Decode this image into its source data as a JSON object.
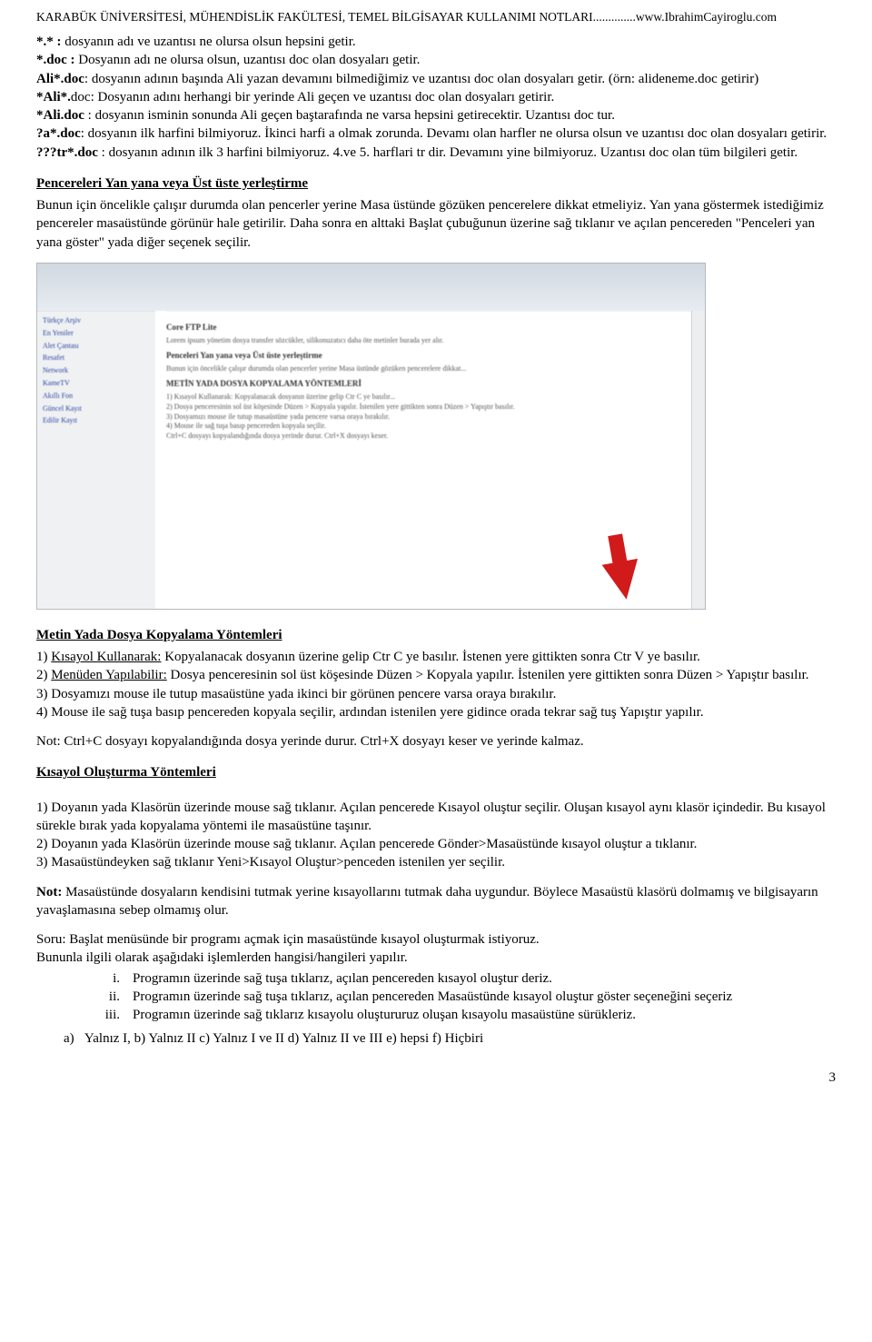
{
  "header": "KARABÜK ÜNİVERSİTESİ, MÜHENDİSLİK FAKÜLTESİ, TEMEL BİLGİSAYAR KULLANIMI NOTLARI..............www.IbrahimCayiroglu.com",
  "wild": {
    "l1a": "*.*  :",
    "l1b": " dosyanın adı ve uzantısı ne olursa olsun hepsini getir.",
    "l2a": "*.doc :",
    "l2b": " Dosyanın adı ne olursa olsun, uzantısı doc olan dosyaları getir.",
    "l3a": "Ali*.doc",
    "l3b": ":  dosyanın adının başında Ali yazan devamını bilmediğimiz ve uzantısı doc olan dosyaları getir. (örn: alideneme.doc getirir)",
    "l4a": "*Ali*.",
    "l4b": "doc: Dosyanın adını herhangi bir yerinde Ali geçen ve uzantısı doc olan dosyaları getirir.",
    "l5a": "*Ali.doc ",
    "l5b": " : dosyanın isminin sonunda Ali geçen baştarafında ne varsa hepsini getirecektir. Uzantısı doc tur.",
    "l6a": "?a*.doc",
    "l6b": ": dosyanın ilk harfini bilmiyoruz. İkinci harfi a olmak zorunda. Devamı olan harfler ne olursa olsun ve uzantısı doc olan dosyaları getirir.",
    "l7a": "???tr*.doc",
    "l7b": " : dosyanın adının ilk 3 harfini bilmiyoruz. 4.ve 5. harflari tr dir. Devamını yine bilmiyoruz. Uzantısı doc olan tüm bilgileri getir."
  },
  "penc": {
    "title": "Pencereleri Yan yana veya Üst üste yerleştirme",
    "body": "Bunun için öncelikle çalışır durumda olan pencerler yerine Masa üstünde gözüken pencerelere dikkat etmeliyiz. Yan yana göstermek istediğimiz pencereler masaüstünde görünür hale getirilir.  Daha sonra en alttaki Başlat çubuğunun üzerine sağ tıklanır ve açılan pencereden \"Penceleri yan yana göster\" yada diğer seçenek seçilir."
  },
  "copy": {
    "title": "Metin Yada Dosya Kopyalama Yöntemleri",
    "i1u": "Kısayol Kullanarak:",
    "i1t": " Kopyalanacak dosyanın üzerine gelip Ctr C ye basılır. İstenen yere gittikten sonra Ctr V ye basılır.",
    "i2u": "Menüden Yapılabilir:",
    "i2t": " Dosya penceresinin sol üst köşesinde Düzen > Kopyala yapılır. İstenilen yere gittikten sonra Düzen > Yapıştır basılır.",
    "i3": "3) Dosyamızı mouse ile tutup masaüstüne yada ikinci bir görünen pencere varsa oraya bırakılır.",
    "i4": "4) Mouse ile sağ tuşa basıp pencereden kopyala seçilir, ardından istenilen yere gidince orada tekrar sağ tuş Yapıştır yapılır.",
    "note": "Not: Ctrl+C dosyayı kopyalandığında dosya yerinde durur. Ctrl+X dosyayı keser  ve yerinde kalmaz."
  },
  "short": {
    "title": "Kısayol Oluşturma Yöntemleri",
    "i1": "1) Doyanın yada Klasörün üzerinde mouse sağ tıklanır. Açılan pencerede Kısayol oluştur seçilir. Oluşan kısayol aynı klasör içindedir. Bu kısayol sürekle bırak yada kopyalama yöntemi ile masaüstüne taşınır.",
    "i2": "2) Doyanın yada Klasörün üzerinde mouse sağ tıklanır. Açılan pencerede Gönder>Masaüstünde kısayol oluştur a tıklanır.",
    "i3": "3) Masaüstündeyken sağ tıklanır Yeni>Kısayol Oluştur>penceden istenilen yer seçilir.",
    "noteLabel": "Not:",
    "noteBody": " Masaüstünde dosyaların kendisini tutmak yerine kısayollarını tutmak daha uygundur. Böylece Masaüstü klasörü dolmamış ve bilgisayarın yavaşlamasına sebep olmamış olur."
  },
  "question": {
    "intro": "Soru: Başlat menüsünde bir programı açmak için masaüstünde kısayol oluşturmak istiyoruz.",
    "line2": "Bununla ilgili olarak aşağıdaki işlemlerden hangisi/hangileri yapılır.",
    "i": "Programın üzerinde sağ tuşa tıklarız, açılan pencereden kısayol oluştur deriz.",
    "ii": "Programın üzerinde sağ tuşa tıklarız, açılan pencereden Masaüstünde kısayol oluştur göster seçeneğini seçeriz",
    "iii": "Programın üzerinde sağ tıklarız kısayolu oluştururuz oluşan kısayolu masaüstüne sürükleriz.",
    "choices": "Yalnız I,  b) Yalnız II c) Yalnız I ve II d) Yalnız II ve III e) hepsi  f) Hiçbiri"
  },
  "pageNumber": "3"
}
